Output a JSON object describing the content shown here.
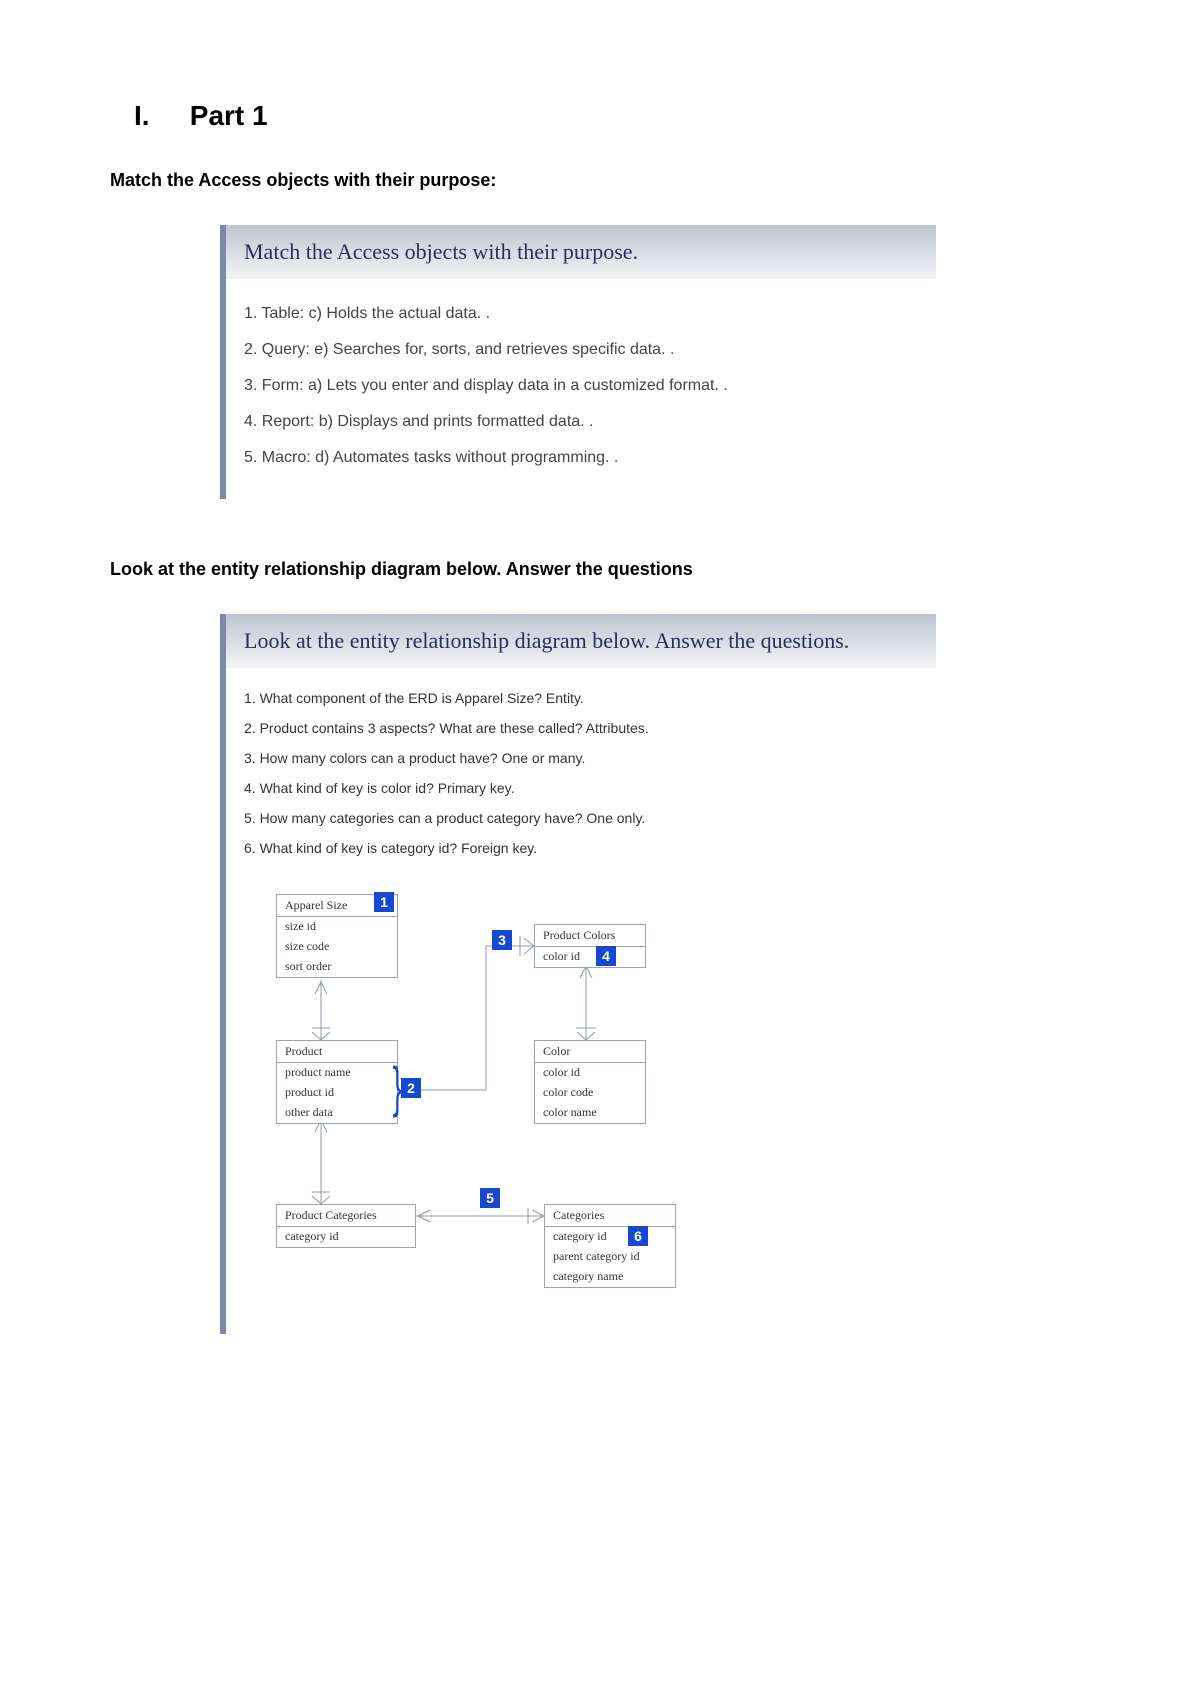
{
  "heading": {
    "roman": "I.",
    "title": "Part 1"
  },
  "section1": {
    "subhead": "Match the Access objects with their purpose:",
    "cardTitle": "Match the Access objects with their purpose.",
    "items": [
      "1. Table: c) Holds the actual data. .",
      "2. Query: e) Searches for, sorts, and retrieves specific data. .",
      "3. Form: a) Lets you enter and display data in a customized format. .",
      "4. Report: b) Displays and prints formatted data. .",
      "5. Macro: d) Automates tasks without programming. ."
    ]
  },
  "section2": {
    "subhead": "Look at the entity relationship diagram below. Answer the questions",
    "cardTitle": "Look at the entity relationship diagram below. Answer the questions.",
    "items": [
      "1. What component of the ERD is Apparel Size? Entity.",
      "2. Product contains 3 aspects? What are these called? Attributes.",
      "3. How many colors can a product have? One or many.",
      "4. What kind of key is color id? Primary key.",
      "5. How many categories can a product category have? One only.",
      "6. What kind of key is category id? Foreign key."
    ]
  },
  "erd": {
    "apparelSize": {
      "title": "Apparel Size",
      "rows": [
        "size id",
        "size code",
        "sort order"
      ]
    },
    "product": {
      "title": "Product",
      "rows": [
        "product name",
        "product id",
        "other data"
      ]
    },
    "productColors": {
      "title": "Product Colors",
      "rows": [
        "color id"
      ]
    },
    "color": {
      "title": "Color",
      "rows": [
        "color id",
        "color code",
        "color name"
      ]
    },
    "productCategories": {
      "title": "Product Categories",
      "rows": [
        "category id"
      ]
    },
    "categories": {
      "title": "Categories",
      "rows": [
        "category id",
        "parent category id",
        "category name"
      ]
    },
    "badges": {
      "1": "1",
      "2": "2",
      "3": "3",
      "4": "4",
      "5": "5",
      "6": "6"
    }
  }
}
